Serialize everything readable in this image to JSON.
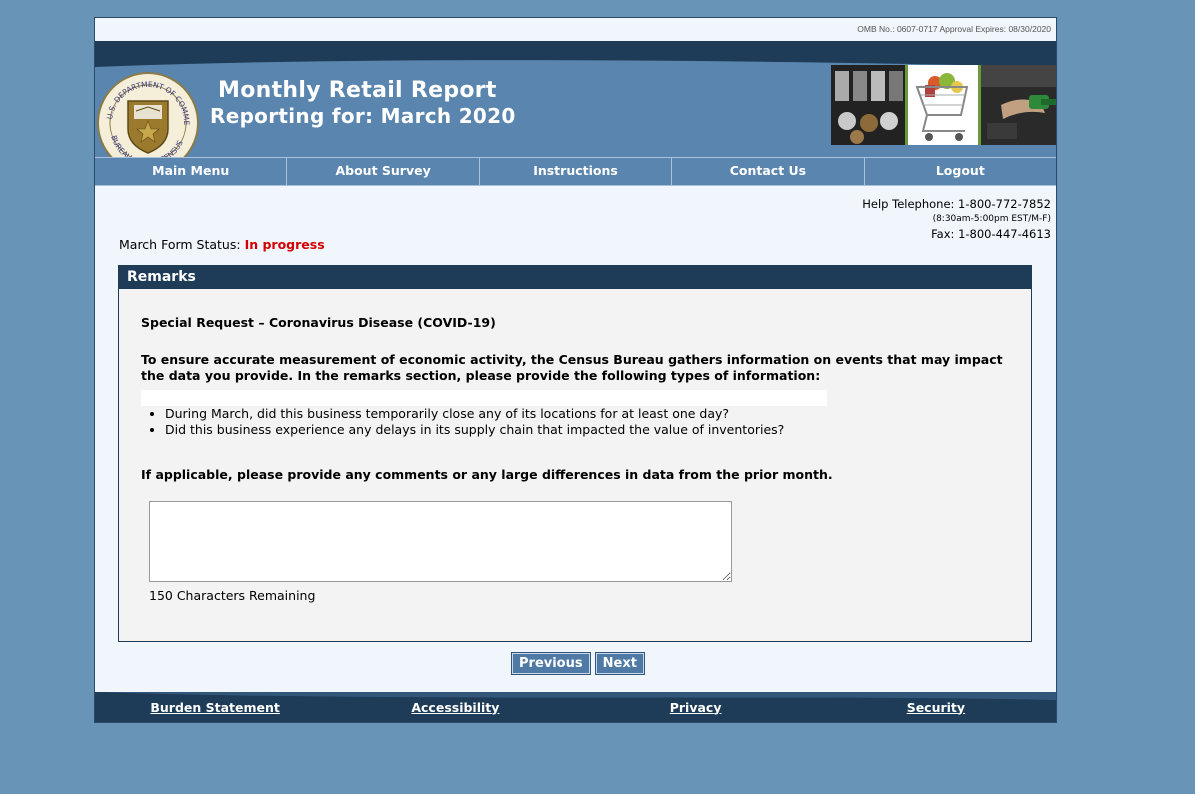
{
  "omb": "OMB No.: 0607-0717 Approval Expires: 08/30/2020",
  "header": {
    "title": "Monthly Retail Report",
    "subtitle": "Reporting for: March 2020",
    "seal_text_top": "U.S. DEPARTMENT OF COMMERCE",
    "seal_text_bottom": "BUREAU OF THE CENSUS"
  },
  "nav": {
    "items": [
      "Main Menu",
      "About Survey",
      "Instructions",
      "Contact Us",
      "Logout"
    ]
  },
  "help": {
    "telephone": "Help Telephone: 1-800-772-7852",
    "hours": "(8:30am-5:00pm EST/M-F)",
    "fax": "Fax: 1-800-447-4613"
  },
  "status": {
    "label": "March Form Status:",
    "value": "In progress"
  },
  "remarks": {
    "heading": "Remarks",
    "special_request": "Special Request – Coronavirus Disease (COVID-19)",
    "intro": "To ensure accurate measurement of economic activity, the Census Bureau gathers information on events that may impact the data you provide. In the remarks section, please provide the following types of information:",
    "questions": [
      "During March, did this business temporarily close any of its locations for at least one day?",
      "Did this business experience any delays in its supply chain that impacted the value of inventories?"
    ],
    "applicable": "If applicable, please provide any comments or any large differences in data from the prior month.",
    "comment_value": "",
    "chars_remaining": "150 Characters Remaining"
  },
  "buttons": {
    "previous": "Previous",
    "next": "Next"
  },
  "footer": {
    "links": [
      "Burden Statement",
      "Accessibility",
      "Privacy",
      "Security"
    ]
  },
  "colors": {
    "page_bg": "#6894b7",
    "banner": "#5a85ae",
    "dark_blue": "#1e3b57",
    "status_red": "#d40000"
  }
}
